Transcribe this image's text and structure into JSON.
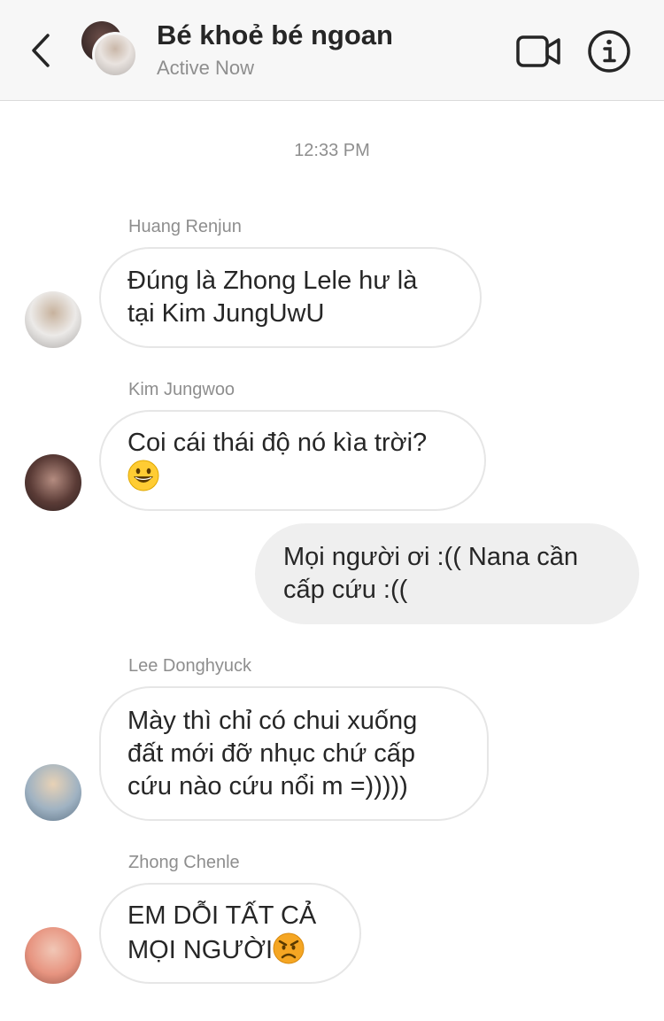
{
  "header": {
    "title": "Bé khoẻ bé ngoan",
    "status": "Active Now",
    "icons": {
      "back": "chevron-left-icon",
      "video": "video-camera-icon",
      "info": "info-icon"
    }
  },
  "timestamp": "12:33 PM",
  "messages": [
    {
      "sender": "Huang Renjun",
      "text": "Đúng là Zhong Lele hư là\ntại Kim JungUwU",
      "direction": "incoming"
    },
    {
      "sender": "Kim Jungwoo",
      "text": "Coi cái thái độ nó kìa trời?\n",
      "emoji": "grinning-face-emoji",
      "direction": "incoming"
    },
    {
      "text": "Mọi người ơi :(( Nana cần\ncấp cứu :((",
      "direction": "outgoing"
    },
    {
      "sender": "Lee Donghyuck",
      "text": "Mày thì chỉ có chui xuống\nđất mới đỡ nhục chứ cấp\ncứu nào cứu nổi m =)))))",
      "direction": "incoming"
    },
    {
      "sender": "Zhong Chenle",
      "text": "EM DỖI TẤT CẢ\nMỌI NGƯỜI",
      "emoji": "angry-face-emoji",
      "direction": "incoming"
    }
  ],
  "colors": {
    "header_bg": "#f7f7f7",
    "incoming_border": "#e6e6e6",
    "outgoing_bg": "#efefef",
    "secondary_text": "#8e8e8e"
  }
}
